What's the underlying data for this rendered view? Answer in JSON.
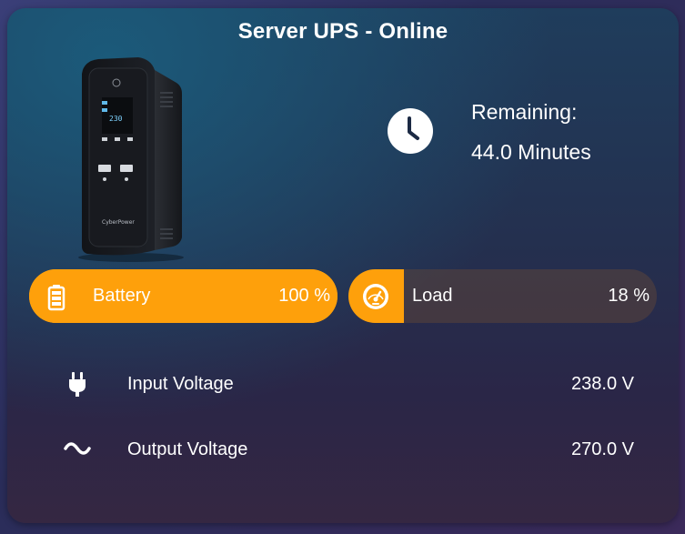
{
  "title": "Server UPS - Online",
  "remaining": {
    "label": "Remaining:",
    "value": "44.0 Minutes",
    "icon": "clock-icon"
  },
  "battery": {
    "label": "Battery",
    "value": "100 %",
    "level": 100,
    "icon": "battery-icon",
    "color": "#fea00b"
  },
  "load": {
    "label": "Load",
    "value": "18 %",
    "level": 18,
    "icon": "gauge-icon",
    "color": "#fea00b"
  },
  "rows": [
    {
      "label": "Input Voltage",
      "value": "238.0 V",
      "icon": "power-plug-icon"
    },
    {
      "label": "Output Voltage",
      "value": "270.0 V",
      "icon": "sine-wave-icon"
    }
  ],
  "ups_image": {
    "icon": "ups-device-image",
    "display_text": "230",
    "brand": "CyberPower"
  }
}
